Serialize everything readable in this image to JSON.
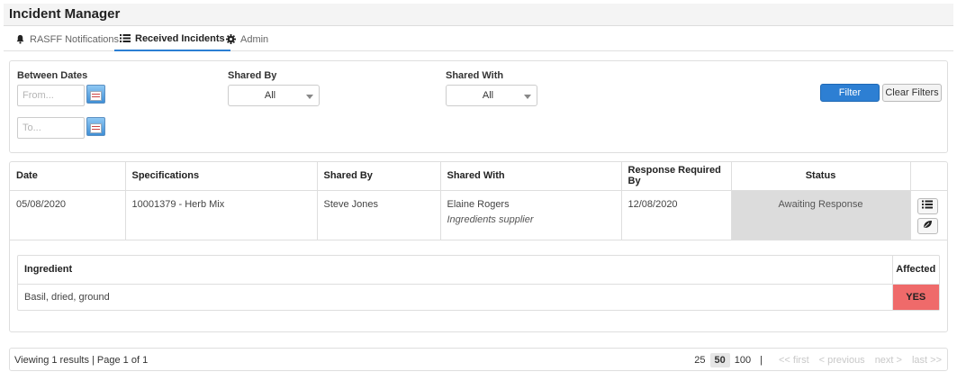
{
  "app": {
    "title": "Incident Manager"
  },
  "tabs": [
    {
      "label": "RASFF Notifications",
      "icon": "bell-icon"
    },
    {
      "label": "Received Incidents",
      "icon": "list-icon"
    },
    {
      "label": "Admin",
      "icon": "gear-icon"
    }
  ],
  "filters": {
    "between_dates_label": "Between Dates",
    "from_placeholder": "From...",
    "to_placeholder": "To...",
    "shared_by_label": "Shared By",
    "shared_by_value": "All",
    "shared_with_label": "Shared With",
    "shared_with_value": "All",
    "filter_button": "Filter",
    "clear_button": "Clear Filters",
    "accent_color": "#2d7fd3"
  },
  "table": {
    "headers": [
      "Date",
      "Specifications",
      "Shared By",
      "Shared With",
      "Response Required By",
      "Status"
    ],
    "rows": [
      {
        "date": "05/08/2020",
        "specification": "10001379 - Herb Mix",
        "shared_by": "Steve Jones",
        "shared_with_name": "Elaine Rogers",
        "shared_with_role": "Ingredients supplier",
        "response_required_by": "12/08/2020",
        "status": "Awaiting Response",
        "actions": [
          "list-icon",
          "leaf-icon"
        ]
      }
    ]
  },
  "ingredients": {
    "headers": [
      "Ingredient",
      "Affected"
    ],
    "rows": [
      {
        "name": "Basil, dried, ground",
        "affected": "YES",
        "affected_color": "#ef6a6a"
      }
    ]
  },
  "footer": {
    "info": "Viewing 1 results | Page 1 of 1",
    "page_sizes": [
      "25",
      "50",
      "100"
    ],
    "active_page_size": "50",
    "separator": "|",
    "nav": [
      "<< first",
      "< previous",
      "next >",
      "last >>"
    ]
  }
}
